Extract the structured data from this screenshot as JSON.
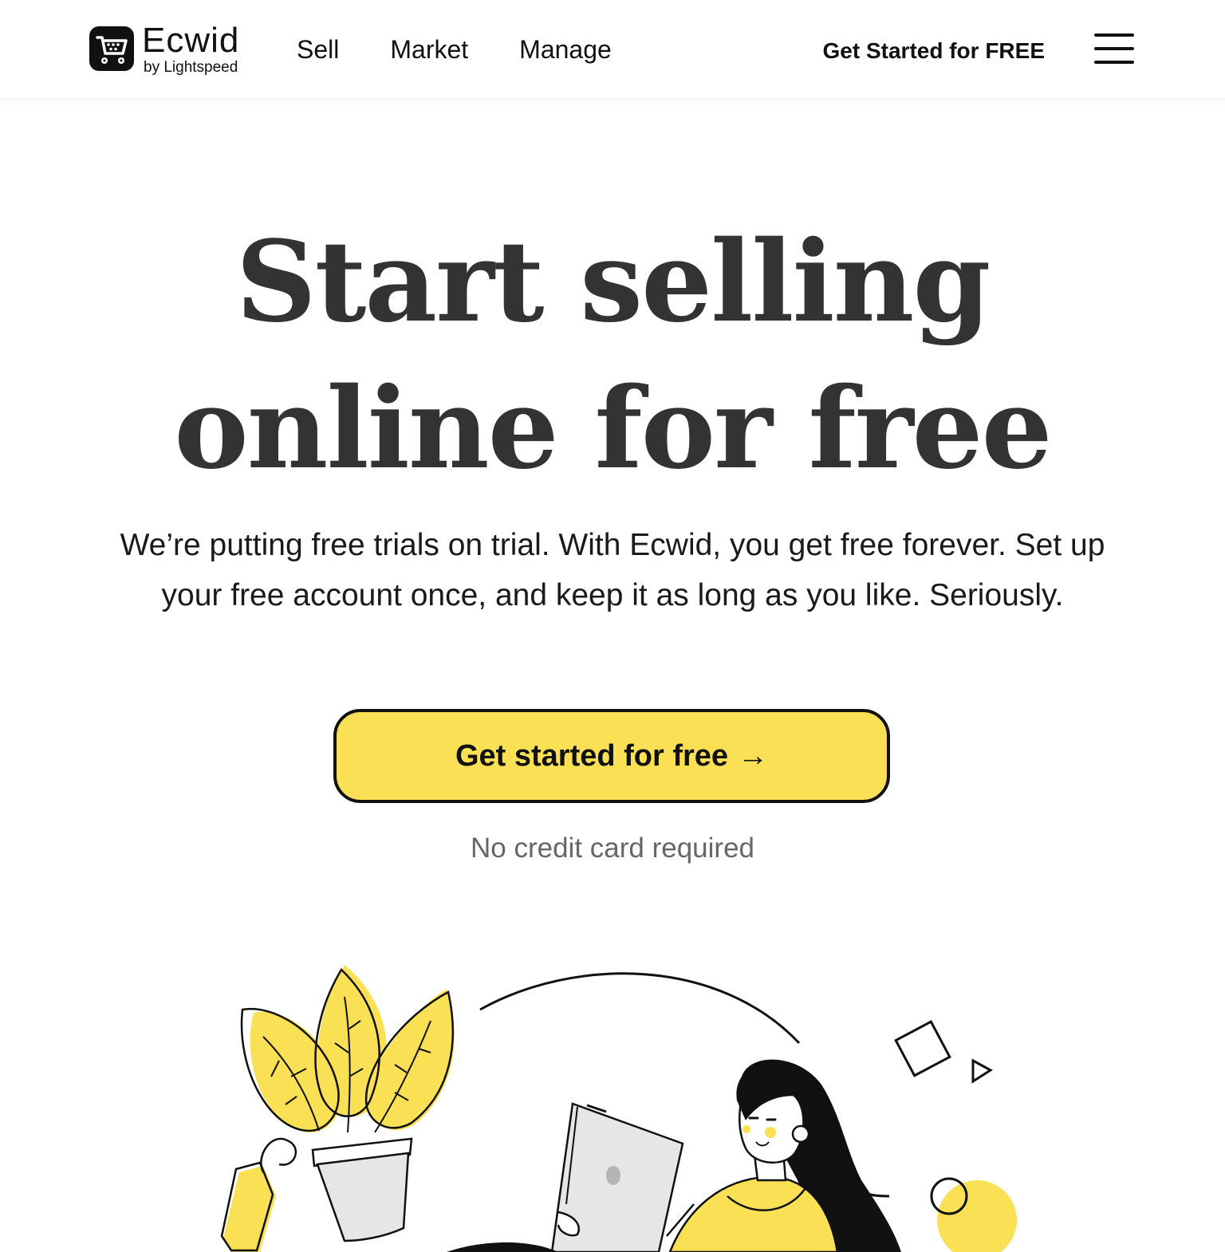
{
  "header": {
    "logo": {
      "name": "Ecwid",
      "sub": "by Lightspeed",
      "icon": "cart-icon"
    },
    "nav": [
      {
        "label": "Sell"
      },
      {
        "label": "Market"
      },
      {
        "label": "Manage"
      }
    ],
    "cta_label": "Get Started for FREE",
    "menu_icon": "hamburger-icon"
  },
  "hero": {
    "title_line1": "Start selling",
    "title_line2": "online for free",
    "subtitle": "We’re putting free trials on trial. With Ecwid, you get free forever. Set up your free account once, and keep it as long as you like. Seriously.",
    "cta_label": "Get started for free",
    "cta_arrow": "→",
    "note": "No credit card required"
  },
  "colors": {
    "accent_yellow": "#f9e054",
    "text_dark": "#333333",
    "text_muted": "#666666"
  },
  "illustration": {
    "icons": [
      "plant-icon",
      "price-tag-icon",
      "laptop-icon",
      "woman-with-laptop-icon",
      "square-shape-icon",
      "triangle-shape-icon",
      "circle-shape-icon"
    ]
  }
}
